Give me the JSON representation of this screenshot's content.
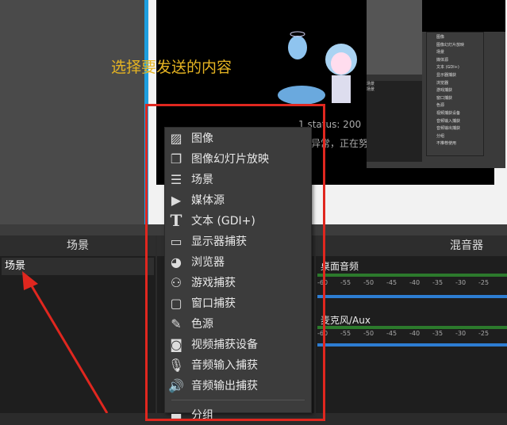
{
  "preview": {
    "title": "选择要发送的内容",
    "status": "1 status: 200",
    "message": "异常，正在努力"
  },
  "scenes": {
    "header": "场景",
    "items": [
      "场景"
    ]
  },
  "mixer": {
    "header": "混音器",
    "tracks": [
      {
        "name": "桌面音频"
      },
      {
        "name": "麦克风/Aux"
      }
    ],
    "ticks": [
      "-60",
      "-55",
      "-50",
      "-45",
      "-40",
      "-35",
      "-30",
      "-25"
    ]
  },
  "menu": {
    "items": [
      {
        "label": "图像",
        "icon": "image-icon"
      },
      {
        "label": "图像幻灯片放映",
        "icon": "slideshow-icon"
      },
      {
        "label": "场景",
        "icon": "list-icon"
      },
      {
        "label": "媒体源",
        "icon": "play-icon"
      },
      {
        "label": "文本 (GDI+)",
        "icon": "text-icon"
      },
      {
        "label": "显示器捕获",
        "icon": "monitor-icon"
      },
      {
        "label": "浏览器",
        "icon": "globe-icon"
      },
      {
        "label": "游戏捕获",
        "icon": "gamepad-icon"
      },
      {
        "label": "窗口捕获",
        "icon": "window-icon"
      },
      {
        "label": "色源",
        "icon": "brush-icon"
      },
      {
        "label": "视频捕获设备",
        "icon": "camera-icon"
      },
      {
        "label": "音频输入捕获",
        "icon": "microphone-icon"
      },
      {
        "label": "音频输出捕获",
        "icon": "speaker-icon"
      }
    ],
    "group_label": "分组"
  },
  "mini_menu": {
    "items": [
      "图像",
      "图像幻灯片放映",
      "场景",
      "媒体源",
      "文本 (GDI+)",
      "显示器捕获",
      "浏览器",
      "游戏捕获",
      "窗口捕获",
      "色源",
      "视频捕获设备",
      "音频输入捕获",
      "音频输出捕获",
      "分组",
      "不推荐使用"
    ],
    "scene_header": "场景",
    "scene_item": "场景"
  },
  "colors": {
    "accent_red": "#e0271f",
    "title_yellow": "#e6b422",
    "meter_green": "#2c7a2c",
    "volume_blue": "#2d7dd2"
  }
}
